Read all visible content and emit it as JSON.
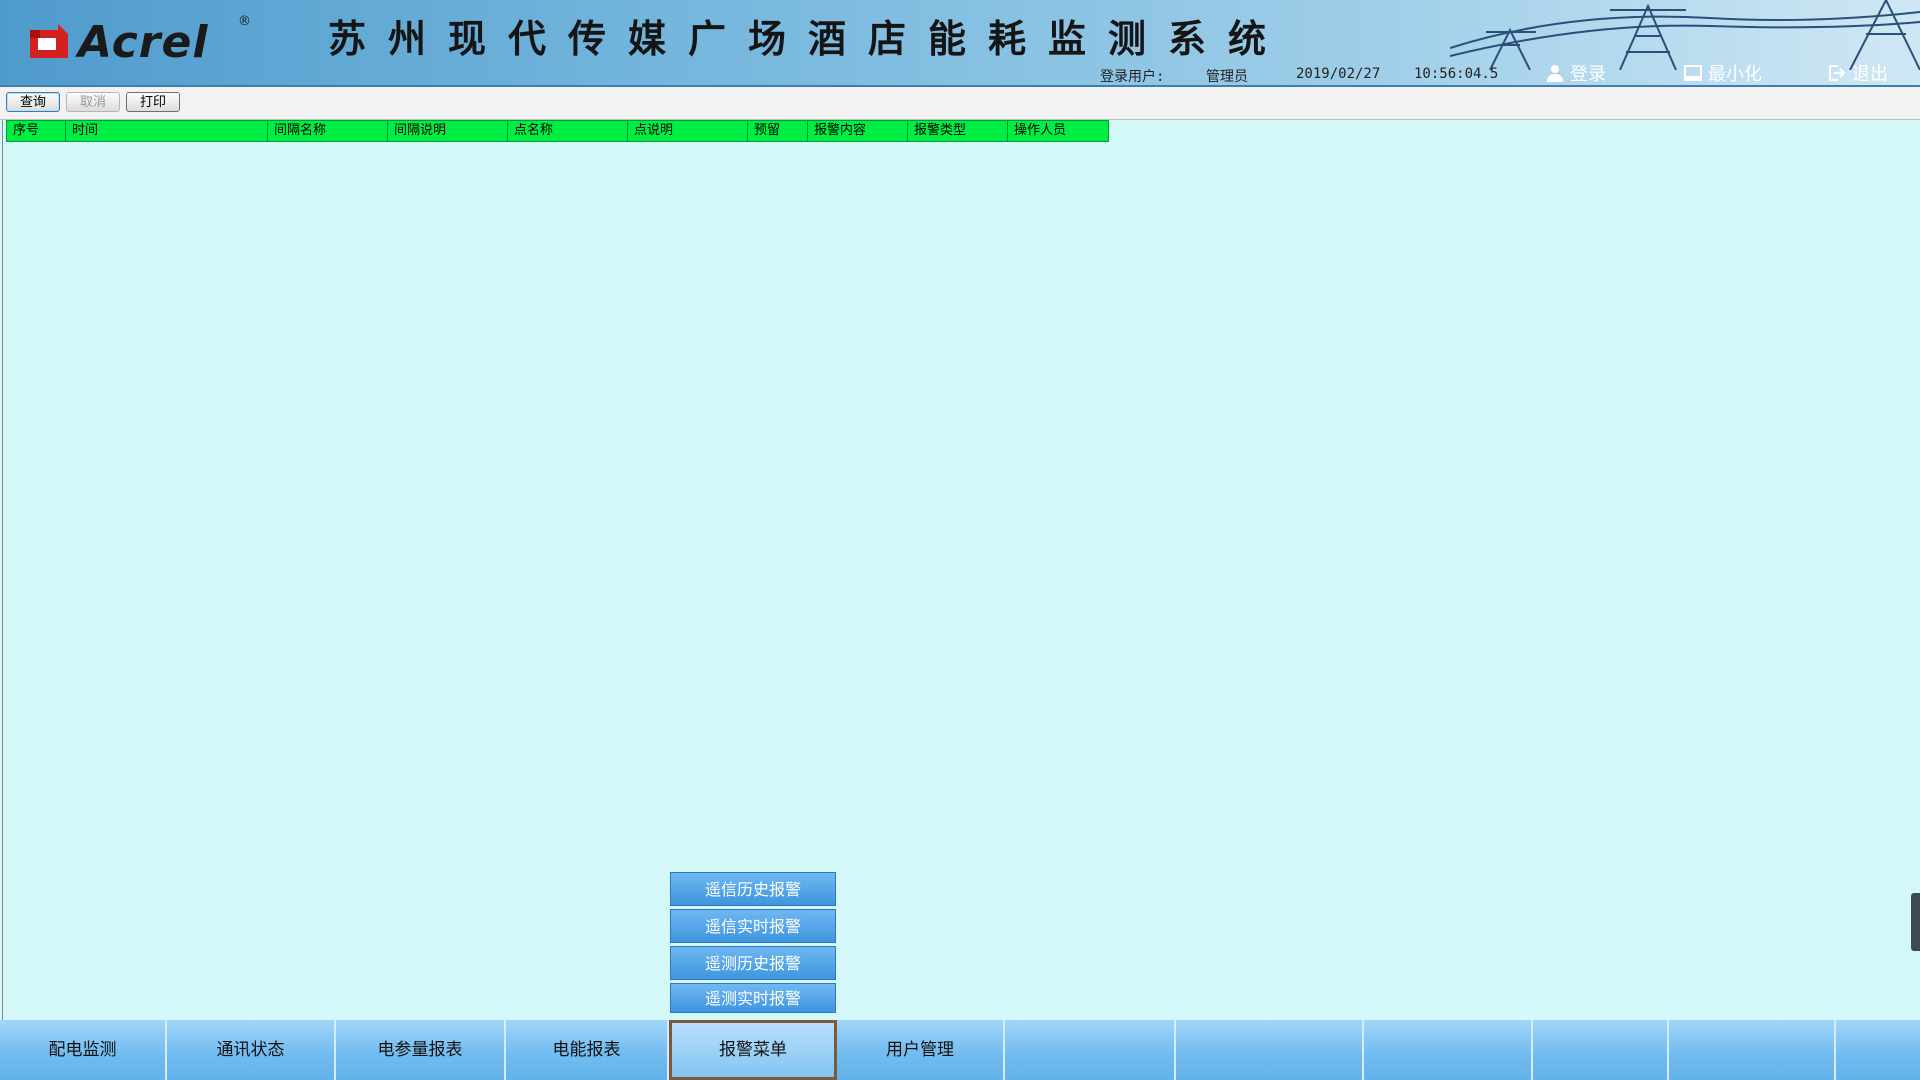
{
  "header": {
    "logo_text": "Acrel",
    "logo_reg": "®",
    "title": "苏州现代传媒广场酒店能耗监测系统",
    "login_label": "登录用户:",
    "user": "管理员",
    "date": "2019/02/27",
    "time": "10:56:04.5",
    "login_button": "登录",
    "minimize_button": "最小化",
    "exit_button": "退出"
  },
  "toolbar": {
    "query": "查询",
    "cancel": "取消",
    "print": "打印"
  },
  "table": {
    "columns": [
      "序号",
      "时间",
      "间隔名称",
      "间隔说明",
      "点名称",
      "点说明",
      "预留",
      "报警内容",
      "报警类型",
      "操作人员"
    ]
  },
  "alarm_menu": {
    "items": [
      "遥信历史报警",
      "遥信实时报警",
      "遥测历史报警",
      "遥测实时报警"
    ]
  },
  "bottom_nav": {
    "tabs": [
      "配电监测",
      "通讯状态",
      "电参量报表",
      "电能报表",
      "报警菜单",
      "用户管理",
      "",
      "",
      "",
      "",
      "",
      ""
    ],
    "active": "报警菜单"
  },
  "colors": {
    "background": "#d4f8f8",
    "table_header": "#00ee44",
    "menu_blue": "#3f95de"
  },
  "icons": {
    "login": "user-icon",
    "minimize": "minimize-icon",
    "exit": "exit-icon"
  }
}
